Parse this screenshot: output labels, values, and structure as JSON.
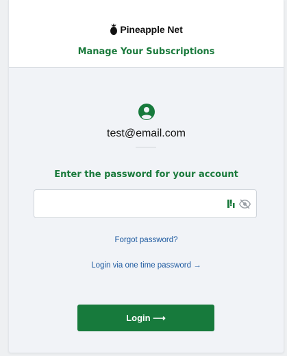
{
  "header": {
    "brand_name": "Pineapple Net",
    "subtitle": "Manage Your Subscriptions"
  },
  "account": {
    "email": "test@email.com"
  },
  "form": {
    "prompt": "Enter the password for your account",
    "password_value": "",
    "password_placeholder": ""
  },
  "links": {
    "forgot_password": "Forgot password?",
    "otp_login": "Login via one time password →"
  },
  "buttons": {
    "login": "Login ⟶"
  },
  "icons": {
    "brand": "pineapple-icon",
    "avatar": "account-circle-icon",
    "password_manager": "password-manager-icon",
    "visibility": "eye-off-icon"
  },
  "colors": {
    "accent_green": "#177a3c",
    "link_blue": "#1e5aa0"
  }
}
